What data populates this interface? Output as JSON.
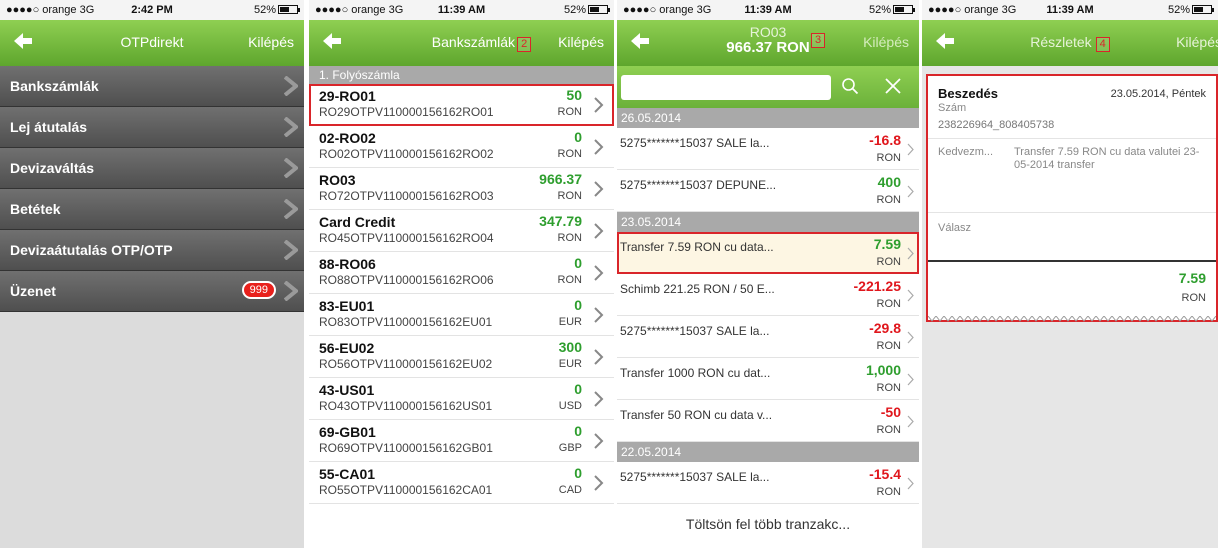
{
  "colors": {
    "accent_green": "#6bb13a",
    "highlight_red": "#d9252a",
    "negative": "#e0161c",
    "positive": "#2e9e2e"
  },
  "screen1": {
    "status": {
      "carrier": "●●●●○ orange  3G",
      "time": "2:42 PM",
      "battery": "52%"
    },
    "nav": {
      "title": "OTPdirekt",
      "exit": "Kilépés"
    },
    "menu": [
      {
        "label": "Bankszámlák"
      },
      {
        "label": "Lej átutalás"
      },
      {
        "label": "Devizaváltás"
      },
      {
        "label": "Betétek"
      },
      {
        "label": "Devizaátutalás OTP/OTP"
      },
      {
        "label": "Üzenet",
        "badge": "999"
      }
    ]
  },
  "screen2": {
    "status": {
      "carrier": "●●●●○ orange  3G",
      "time": "11:39 AM",
      "battery": "52%"
    },
    "nav": {
      "title": "Bankszámlák",
      "marker": "2",
      "exit": "Kilépés"
    },
    "section": "1. Folyószámla",
    "accounts": [
      {
        "name": "29-RO01",
        "iban": "RO29OTPV110000156162RO01",
        "amount": "50",
        "currency": "RON"
      },
      {
        "name": "02-RO02",
        "iban": "RO02OTPV110000156162RO02",
        "amount": "0",
        "currency": "RON"
      },
      {
        "name": "RO03",
        "iban": "RO72OTPV110000156162RO03",
        "amount": "966.37",
        "currency": "RON"
      },
      {
        "name": "Card Credit",
        "iban": "RO45OTPV110000156162RO04",
        "amount": "347.79",
        "currency": "RON"
      },
      {
        "name": "88-RO06",
        "iban": "RO88OTPV110000156162RO06",
        "amount": "0",
        "currency": "RON"
      },
      {
        "name": "83-EU01",
        "iban": "RO83OTPV110000156162EU01",
        "amount": "0",
        "currency": "EUR"
      },
      {
        "name": "56-EU02",
        "iban": "RO56OTPV110000156162EU02",
        "amount": "300",
        "currency": "EUR"
      },
      {
        "name": "43-US01",
        "iban": "RO43OTPV110000156162US01",
        "amount": "0",
        "currency": "USD"
      },
      {
        "name": "69-GB01",
        "iban": "RO69OTPV110000156162GB01",
        "amount": "0",
        "currency": "GBP"
      },
      {
        "name": "55-CA01",
        "iban": "RO55OTPV110000156162CA01",
        "amount": "0",
        "currency": "CAD"
      }
    ]
  },
  "screen3": {
    "status": {
      "carrier": "●●●●○ orange  3G",
      "time": "11:39 AM",
      "battery": "52%"
    },
    "nav": {
      "account": "RO03",
      "balance": "966.37 RON",
      "marker": "3",
      "exit": "Kilépés"
    },
    "groups": [
      {
        "date": "26.05.2014",
        "items": [
          {
            "desc": "5275*******15037 SALE la...",
            "amount": "-16.8",
            "currency": "RON",
            "sign": "neg"
          },
          {
            "desc": "5275*******15037 DEPUNE...",
            "amount": "400",
            "currency": "RON",
            "sign": "pos"
          }
        ]
      },
      {
        "date": "23.05.2014",
        "items": [
          {
            "desc": "Transfer 7.59 RON cu data...",
            "amount": "7.59",
            "currency": "RON",
            "sign": "pos"
          },
          {
            "desc": "Schimb 221.25 RON / 50 E...",
            "amount": "-221.25",
            "currency": "RON",
            "sign": "neg"
          },
          {
            "desc": "5275*******15037 SALE la...",
            "amount": "-29.8",
            "currency": "RON",
            "sign": "neg"
          },
          {
            "desc": "Transfer 1000 RON cu dat...",
            "amount": "1,000",
            "currency": "RON",
            "sign": "pos"
          },
          {
            "desc": "Transfer 50 RON cu data v...",
            "amount": "-50",
            "currency": "RON",
            "sign": "neg"
          }
        ]
      },
      {
        "date": "22.05.2014",
        "items": [
          {
            "desc": "5275*******15037 SALE la...",
            "amount": "-15.4",
            "currency": "RON",
            "sign": "neg"
          }
        ]
      }
    ],
    "load_more": "Töltsön fel több tranzakc..."
  },
  "screen4": {
    "status": {
      "carrier": "●●●●○ orange  3G",
      "time": "11:39 AM",
      "battery": "52%"
    },
    "nav": {
      "title": "Részletek",
      "marker": "4",
      "exit": "Kilépés"
    },
    "detail": {
      "title": "Beszedés",
      "date": "23.05.2014, Péntek",
      "number_label": "Szám",
      "number": "238226964_808405738",
      "beneficiary_label": "Kedvezm...",
      "beneficiary": "Transfer 7.59 RON cu data valutei 23-05-2014 transfer",
      "reply_label": "Válasz",
      "amount": "7.59",
      "currency": "RON"
    }
  }
}
